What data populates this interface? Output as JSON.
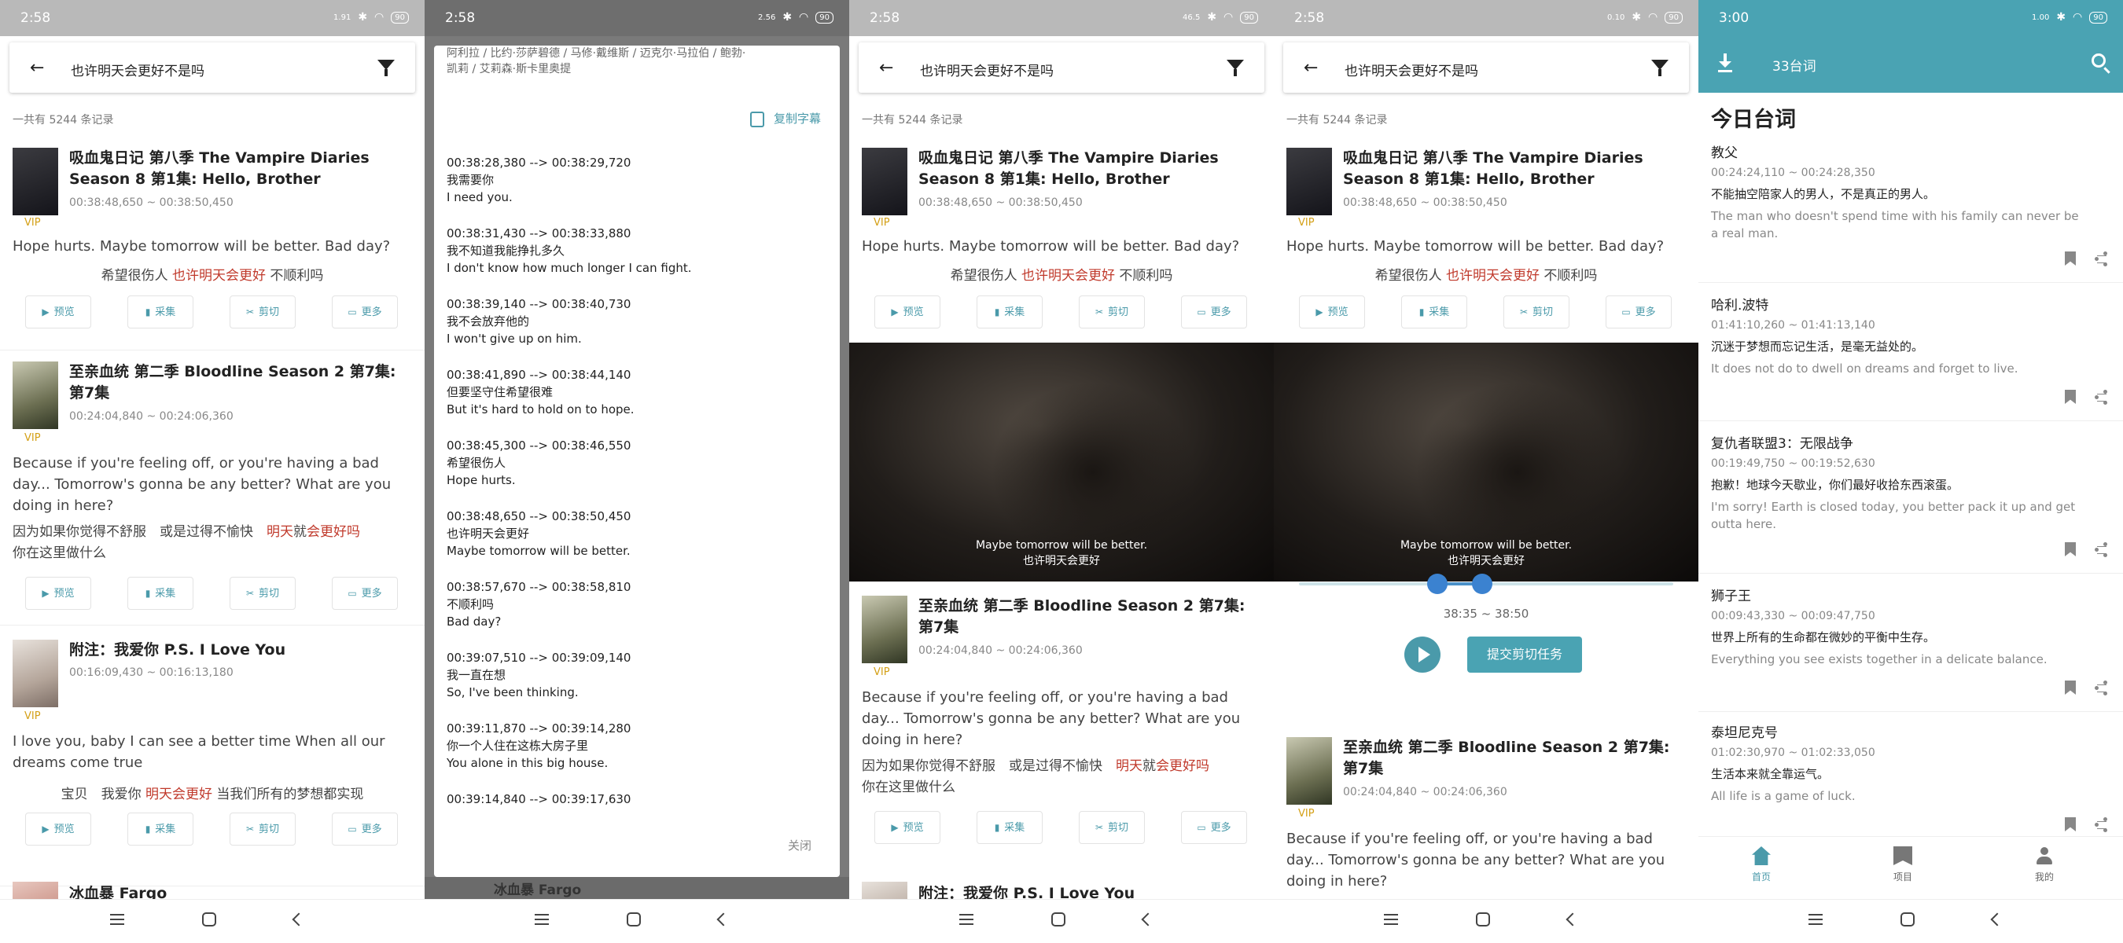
{
  "status": {
    "time1": "2:58",
    "time2": "2:58",
    "time3": "2:58",
    "time4": "2:58",
    "time5": "3:00",
    "battery": "90",
    "speed1": "1.91",
    "speed2": "2.56",
    "speed3": "46.5",
    "speed4": "0.10",
    "speed5": "1.00",
    "speed_unit": "KB/s"
  },
  "search": {
    "query": "也许明天会更好不是吗"
  },
  "result_count": "一共有 5244 条记录",
  "buttons": {
    "preview": "预览",
    "collect": "采集",
    "cut": "剪切",
    "more": "更多"
  },
  "vip": "VIP",
  "results": [
    {
      "title": "吸血鬼日记 第八季 The Vampire Diaries Season 8 第1集: Hello, Brother",
      "time": "00:38:48,650 ~ 00:38:50,450",
      "en": "Hope hurts. Maybe tomorrow will be better. Bad day?",
      "zh_pre": "希望很伤人 ",
      "zh_hl": "也许明天会更好",
      "zh_post": " 不顺利吗"
    },
    {
      "title": "至亲血统 第二季 Bloodline Season 2 第7集: 第7集",
      "time": "00:24:04,840 ~ 00:24:06,360",
      "en": "Because if you're feeling off, or you're having a bad day... Tomorrow's gonna be any better? What are you doing in here?",
      "zh_pre": "因为如果你觉得不舒服　或是过得不愉快　",
      "zh_hl": "明天",
      "zh_mid": "就",
      "zh_hl2": "会更好吗",
      "zh_post": "你在这里做什么"
    },
    {
      "title": "附注：我爱你 P.S. I Love You",
      "time": "00:16:09,430 ~ 00:16:13,180",
      "en": "I love you, baby I can see a better time When all our dreams come true",
      "zh_pre": "宝贝　我爱你 ",
      "zh_hl": "明天会更好",
      "zh_post": " 当我们所有的梦想都实现"
    },
    {
      "title": "冰血暴 Fargo"
    }
  ],
  "dialog": {
    "header1": "阿利拉 / 比约·莎萨碧德 / 马修·戴维斯 / 迈克尔·马拉伯 / 鲍勃·",
    "header2": "凯莉 / 艾莉森·斯卡里奥提",
    "copy": "复制字幕",
    "close": "关闭",
    "subs": [
      {
        "time": "00:38:28,380 --> 00:38:29,720",
        "zh": "我需要你",
        "en": "I need you."
      },
      {
        "time": "00:38:31,430 --> 00:38:33,880",
        "zh": "我不知道我能挣扎多久",
        "en": "I don't know how much longer I can fight."
      },
      {
        "time": "00:38:39,140 --> 00:38:40,730",
        "zh": "我不会放弃他的",
        "en": "I won't give up on him."
      },
      {
        "time": "00:38:41,890 --> 00:38:44,140",
        "zh": "但要坚守住希望很难",
        "en": "But it's hard to hold on to hope."
      },
      {
        "time": "00:38:45,300 --> 00:38:46,550",
        "zh": "希望很伤人",
        "en": "Hope hurts."
      },
      {
        "time": "00:38:48,650 --> 00:38:50,450",
        "zh": "也许明天会更好",
        "en": "Maybe tomorrow will be better."
      },
      {
        "time": "00:38:57,670 --> 00:38:58,810",
        "zh": "不顺利吗",
        "en": "Bad day?"
      },
      {
        "time": "00:39:07,510 --> 00:39:09,140",
        "zh": "我一直在想",
        "en": "So, I've been thinking."
      },
      {
        "time": "00:39:11,870 --> 00:39:14,280",
        "zh": "你一个人住在这栋大房子里",
        "en": "You alone in this big house."
      },
      {
        "time": "00:39:14,840 --> 00:39:17,630",
        "zh": "",
        "en": ""
      }
    ]
  },
  "video": {
    "cap_en": "Maybe tomorrow will be better.",
    "cap_zh": "也许明天会更好"
  },
  "clip": {
    "range": "38:35 ~ 38:50",
    "submit": "提交剪切任务",
    "start": 0.37,
    "end": 0.49
  },
  "app": {
    "name": "33台词",
    "today": "今日台词",
    "entries": [
      {
        "movie": "教父",
        "time": "00:24:24,110 ~ 00:24:28,350",
        "zh": "不能抽空陪家人的男人，不是真正的男人。",
        "en": "The man who doesn't spend time with his family  can never be a real man."
      },
      {
        "movie": "哈利.波特",
        "time": "01:41:10,260 ~ 01:41:13,140",
        "zh": "沉迷于梦想而忘记生活，是毫无益处的。",
        "en": "It does not do to dwell on dreams and forget to live."
      },
      {
        "movie": "复仇者联盟3：无限战争",
        "time": "00:19:49,750 ~ 00:19:52,630",
        "zh": "抱歉！地球今天歇业，你们最好收拾东西滚蛋。",
        "en": "I'm sorry! Earth is closed today, you better pack it up and get outta here."
      },
      {
        "movie": "狮子王",
        "time": "00:09:43,330 ~ 00:09:47,750",
        "zh": "世界上所有的生命都在微妙的平衡中生存。",
        "en": "Everything you see exists together in a delicate balance."
      },
      {
        "movie": "泰坦尼克号",
        "time": "01:02:30,970 ~ 01:02:33,050",
        "zh": "生活本来就全靠运气。",
        "en": "All life is a game of luck."
      }
    ],
    "nav": {
      "home": "首页",
      "project": "项目",
      "mine": "我的"
    }
  },
  "colors": {
    "accent": "#4aa3b3",
    "highlight": "#c0392b",
    "vip": "#d4a017"
  }
}
